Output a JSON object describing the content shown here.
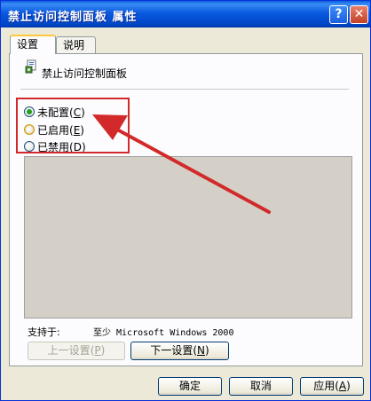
{
  "window": {
    "title": "禁止访问控制面板 属性",
    "help_glyph": "?",
    "close_glyph": "✕"
  },
  "tabs": [
    {
      "label": "设置"
    },
    {
      "label": "说明"
    }
  ],
  "policy": {
    "name": "禁止访问控制面板",
    "icon": "policy-icon"
  },
  "options": [
    {
      "label": "未配置",
      "key": "C",
      "checked": true
    },
    {
      "label": "已启用",
      "key": "E",
      "checked": false
    },
    {
      "label": "已禁用",
      "key": "D",
      "checked": false
    }
  ],
  "supported": {
    "label": "支持于:",
    "value": "至少 Microsoft Windows 2000"
  },
  "nav": {
    "prev": {
      "label": "上一设置",
      "key": "P"
    },
    "next": {
      "label": "下一设置",
      "key": "N"
    }
  },
  "footer": {
    "ok": "确定",
    "cancel": "取消",
    "apply": {
      "label": "应用",
      "key": "A"
    }
  },
  "annotation": {
    "color": "#d22a2a"
  },
  "colors": {
    "title_bar": "#0a59e0",
    "dialog_bg": "#ece9d8",
    "selected_radio": "#21a121"
  }
}
